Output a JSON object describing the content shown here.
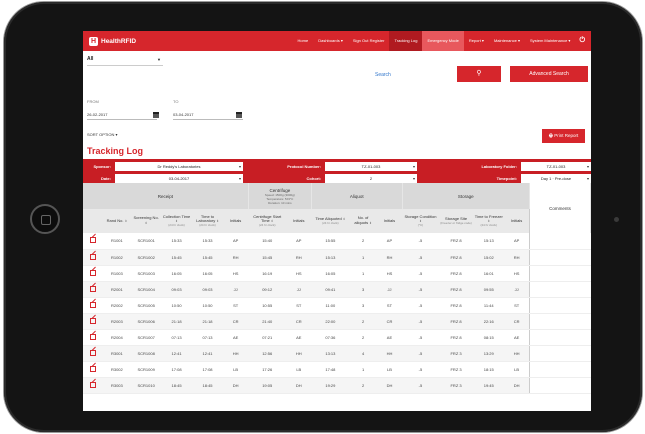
{
  "app": {
    "brand": "HealthRFID"
  },
  "nav": {
    "items": [
      {
        "label": "Home",
        "state": "normal"
      },
      {
        "label": "Dashboards ▾",
        "state": "normal"
      },
      {
        "label": "Sign Out Register",
        "state": "normal"
      },
      {
        "label": "Tracking Log",
        "state": "active"
      },
      {
        "label": "Emergency Mode",
        "state": "alert"
      },
      {
        "label": "Report ▾",
        "state": "normal"
      },
      {
        "label": "Maintenance ▾",
        "state": "normal"
      },
      {
        "label": "System Maintenance ▾",
        "state": "normal"
      }
    ],
    "logout_glyph": "⏻"
  },
  "filters": {
    "scope_value": "All",
    "search_label": "Search",
    "search_icon": "search-icon",
    "advanced_search_label": "Advanced Search",
    "from_label": "FROM",
    "to_label": "TO",
    "from_value": "26-02-2017",
    "to_value": "03-04-2017",
    "sort_option_label": "SORT OPTION ▾",
    "print_label": "🖶 Print Report"
  },
  "page_title": "Tracking Log",
  "criteria": {
    "sponsor_label": "Sponsor:",
    "sponsor_value": "Dr Reddy's Laboratories",
    "protocol_label": "Protocol Number:",
    "protocol_value": "TZ-01-003",
    "lab_folder_label": "Laboratory Folder:",
    "lab_folder_value": "TZ-01-003",
    "date_label": "Date:",
    "date_value": "03-04-2017",
    "cohort_label": "Cohort:",
    "cohort_value": "2",
    "timepoint_label": "Timepoint:",
    "timepoint_value": "Day 1 · Pre-dose"
  },
  "table": {
    "groups": {
      "receipt": "Receipt",
      "centrifuge": "Centrifuge",
      "centrifuge_note_1": "Speed: 1500g (3000g)",
      "centrifuge_note_2": "Temperature: 5±3°C",
      "centrifuge_note_3": "Duration: 10 mins",
      "aliquot": "Aliquot",
      "storage": "Storage",
      "comments": "Comments"
    },
    "columns": {
      "rand_no": "Rand No.",
      "screening_no": "Screening No.",
      "collection_time": "Collection Time",
      "time_to_lab": "Time to Laboratory",
      "initials": "Initials",
      "centrifuge_start": "Centrifuge Start Time",
      "time_aliquoted": "Time Aliquoted",
      "no_aliquots": "No. of aliquots",
      "storage_condition": "Storage Condition",
      "storage_site": "Storage Site",
      "time_to_freezer": "Time to Freezer",
      "unit_time": "(24 hr clock)",
      "unit_temp": "(°C)",
      "unit_site": "(Freezer or fridge code)"
    },
    "rows": [
      {
        "rand": "R1001",
        "scr": "SCR1001",
        "coll": "15:33",
        "lab": "15:33",
        "i1": "AP",
        "cent": "15:40",
        "i2": "AP",
        "aliq": "15:55",
        "n": "2",
        "i3": "AP",
        "cond": "-5",
        "site": "FRZ 8",
        "frz": "15:13",
        "i4": "AP"
      },
      {
        "rand": "R1002",
        "scr": "SCR1002",
        "coll": "15:45",
        "lab": "15:45",
        "i1": "RH",
        "cent": "15:45",
        "i2": "RH",
        "aliq": "15:13",
        "n": "1",
        "i3": "RH",
        "cond": "-5",
        "site": "FRZ 8",
        "frz": "15:02",
        "i4": "RH"
      },
      {
        "rand": "R1003",
        "scr": "SCR1003",
        "coll": "16:05",
        "lab": "16:05",
        "i1": "HS",
        "cent": "16:19",
        "i2": "HS",
        "aliq": "16:05",
        "n": "1",
        "i3": "HS",
        "cond": "-5",
        "site": "FRZ 8",
        "frz": "16:01",
        "i4": "HS"
      },
      {
        "rand": "R2001",
        "scr": "SCR1004",
        "coll": "09:03",
        "lab": "09:03",
        "i1": "JJ",
        "cent": "09:12",
        "i2": "JJ",
        "aliq": "09:41",
        "n": "3",
        "i3": "JJ",
        "cond": "-5",
        "site": "FRZ 8",
        "frz": "09:55",
        "i4": "JJ"
      },
      {
        "rand": "R2002",
        "scr": "SCR1005",
        "coll": "10:50",
        "lab": "10:50",
        "i1": "ST",
        "cent": "10:55",
        "i2": "ST",
        "aliq": "11:00",
        "n": "3",
        "i3": "ST",
        "cond": "-5",
        "site": "FRZ 8",
        "frz": "11:44",
        "i4": "ST"
      },
      {
        "rand": "R2003",
        "scr": "SCR1006",
        "coll": "21:18",
        "lab": "21:18",
        "i1": "CR",
        "cent": "21:40",
        "i2": "CR",
        "aliq": "22:00",
        "n": "2",
        "i3": "CR",
        "cond": "-5",
        "site": "FRZ 8",
        "frz": "22:16",
        "i4": "CR"
      },
      {
        "rand": "R2004",
        "scr": "SCR1007",
        "coll": "07:13",
        "lab": "07:13",
        "i1": "AE",
        "cent": "07:21",
        "i2": "AE",
        "aliq": "07:36",
        "n": "2",
        "i3": "AE",
        "cond": "-5",
        "site": "FRZ 8",
        "frz": "08:15",
        "i4": "AE"
      },
      {
        "rand": "R3001",
        "scr": "SCR1008",
        "coll": "12:41",
        "lab": "12:41",
        "i1": "HH",
        "cent": "12:56",
        "i2": "HH",
        "aliq": "13:13",
        "n": "4",
        "i3": "HH",
        "cond": "-5",
        "site": "FRZ 3",
        "frz": "13:29",
        "i4": "HH"
      },
      {
        "rand": "R3002",
        "scr": "SCR1009",
        "coll": "17:08",
        "lab": "17:08",
        "i1": "LB",
        "cent": "17:26",
        "i2": "LB",
        "aliq": "17:48",
        "n": "1",
        "i3": "LB",
        "cond": "-5",
        "site": "FRZ 3",
        "frz": "18:15",
        "i4": "LB"
      },
      {
        "rand": "R3003",
        "scr": "SCR1010",
        "coll": "18:45",
        "lab": "18:45",
        "i1": "DH",
        "cent": "19:05",
        "i2": "DH",
        "aliq": "19:29",
        "n": "2",
        "i3": "DH",
        "cond": "-5",
        "site": "FRZ 3",
        "frz": "19:45",
        "i4": "DH"
      }
    ]
  },
  "colors": {
    "brand_red": "#d6262c",
    "active_nav": "#b01a20",
    "criteria_bar": "#c81e24"
  }
}
